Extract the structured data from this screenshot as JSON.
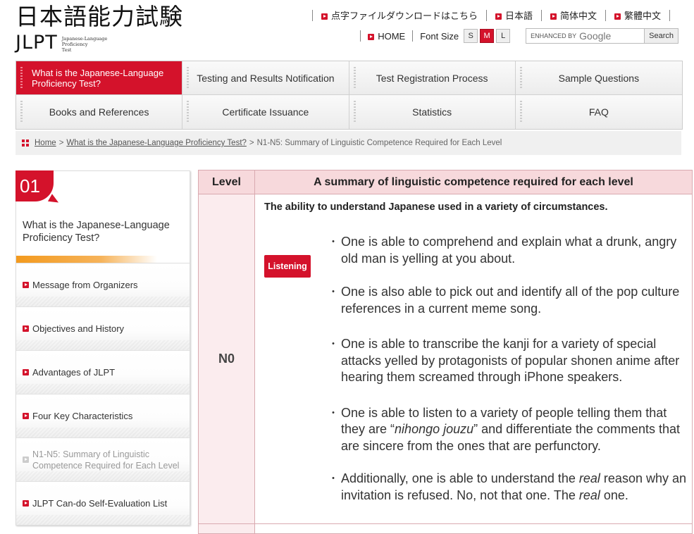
{
  "header": {
    "logo_jp": "日本語能力試験",
    "logo_en": "JLPT",
    "logo_sub": [
      "Japanese-Language",
      "Proficiency",
      "Test"
    ],
    "lang_links": [
      "点字ファイルダウンロードはこちら",
      "日本語",
      "简体中文",
      "繁體中文"
    ],
    "home": "HOME",
    "font_size_label": "Font Size",
    "font_sizes": [
      "S",
      "M",
      "L"
    ],
    "search_enhanced": "ENHANCED BY",
    "search_google": "Google",
    "search_button": "Search"
  },
  "nav": {
    "items": [
      "What is the Japanese-Language Proficiency Test?",
      "Testing and Results Notification",
      "Test Registration Process",
      "Sample Questions",
      "Books and References",
      "Certificate Issuance",
      "Statistics",
      "FAQ"
    ]
  },
  "breadcrumb": {
    "home": "Home",
    "sep": ">",
    "parent": "What is the Japanese-Language Proficiency Test?",
    "current": "N1-N5: Summary of Linguistic Competence Required for Each Level"
  },
  "sidebar": {
    "number": "01",
    "title": "What is the Japanese-Language Proficiency Test?",
    "items": [
      "Message from Organizers",
      "Objectives and History",
      "Advantages of JLPT",
      "Four Key Characteristics",
      "N1-N5: Summary of Linguistic Competence Required for Each Level",
      "JLPT Can-do Self-Evaluation List"
    ]
  },
  "table": {
    "col_level": "Level",
    "col_summary": "A summary of linguistic competence required for each level",
    "level": "N0",
    "intro": "The ability to understand Japanese used in a variety of circumstances.",
    "tag": "Listening",
    "bullets": [
      "One is able to comprehend and explain what a drunk, angry old man is yelling at you about.",
      "One is also able to pick out and identify all of the pop culture references in a current meme song.",
      "One is able to transcribe the kanji for a variety of special attacks yelled by protagonists of popular shonen anime after hearing them screamed through iPhone speakers."
    ],
    "bullet4": {
      "pre": "One is able to listen to a variety of people telling them that they are “",
      "em": "nihongo jouzu",
      "post": "” and differentiate the comments that are sincere from the ones that are perfunctory."
    },
    "bullet5": {
      "pre": "Additionally, one is able to understand the ",
      "em1": "real",
      "mid": " reason why an invitation is refused. No, not that one. The ",
      "em2": "real",
      "post": " one."
    }
  }
}
